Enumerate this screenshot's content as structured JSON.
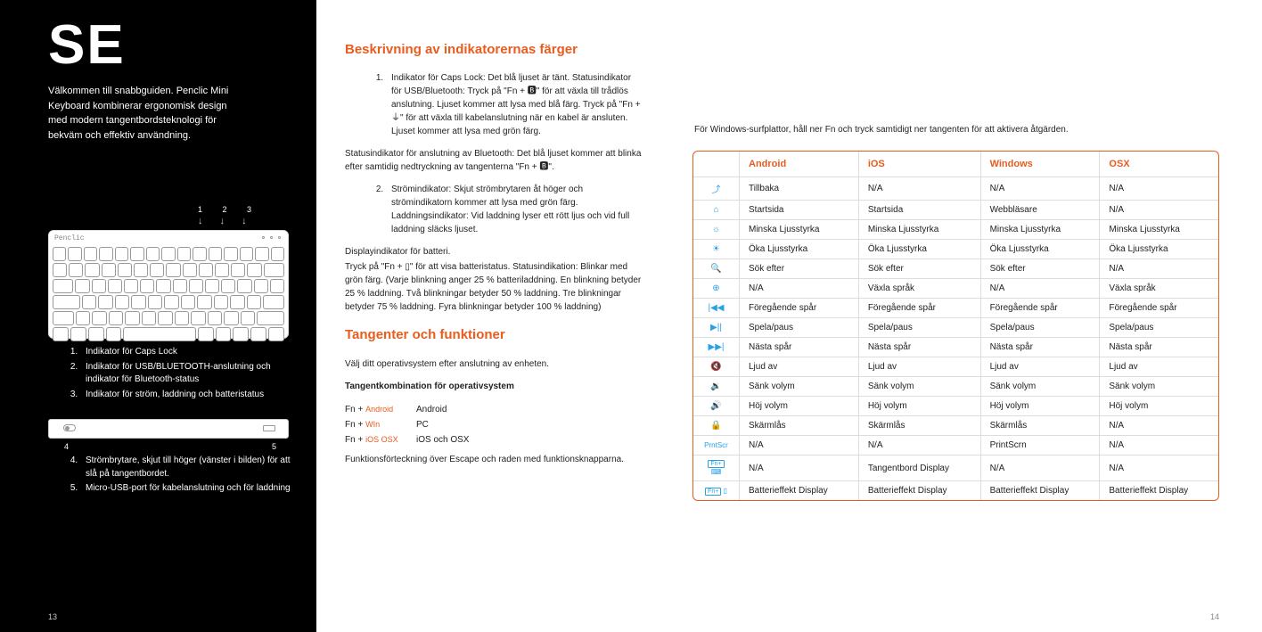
{
  "left": {
    "title": "SE",
    "intro": "Välkommen till snabbguiden. Penclic Mini Keyboard kombinerar ergonomisk design med modern tangentbordsteknologi för bekväm och effektiv användning.",
    "kb_labels": "1 2 3",
    "kb_brand": "Penclic",
    "list1": {
      "i1": "Indikator för Caps Lock",
      "i2": "Indikator för USB/BLUETOOTH-anslutning och indikator för Bluetooth-status",
      "i3": "Indikator för ström, laddning och batteristatus"
    },
    "usb_labels": {
      "l": "4",
      "r": "5"
    },
    "list2": {
      "i4": "Strömbrytare, skjut till höger (vänster i bilden) för att slå på tangentbordet.",
      "i5": "Micro-USB-port för kabelanslutning och för laddning"
    },
    "page": "13"
  },
  "mid": {
    "h1": "Beskrivning av indikatorernas färger",
    "desc1": "Indikator för Caps Lock: Det blå ljuset är tänt. Statusindikator för USB/Bluetooth: Tryck på \"Fn + 🅱\" för att växla till trådlös anslutning. Ljuset kommer att lysa med blå färg. Tryck på \"Fn + ⏚\" för att växla till kabelanslutning när en kabel är ansluten. Ljuset kommer att lysa med grön färg.",
    "para1": "Statusindikator för anslutning av Bluetooth: Det blå ljuset kommer att blinka efter samtidig nedtryckning av tangenterna \"Fn + 🅱\".",
    "desc2": "Strömindikator: Skjut strömbrytaren åt höger och strömindikatorn kommer att lysa med grön färg. Laddningsindikator: Vid laddning lyser ett rött ljus och vid full laddning släcks ljuset.",
    "para2a": "Displayindikator för batteri.",
    "para2b": "Tryck på \"Fn + ▯\" för att visa batteristatus. Statusindikation: Blinkar med grön färg. (Varje blinkning anger 25 % batteriladdning. En blinkning betyder 25 % laddning. Två blinkningar betyder 50 % laddning. Tre blinkningar betyder 75 % laddning. Fyra blinkningar betyder 100 % laddning)",
    "h2": "Tangenter och funktioner",
    "para3": "Välj ditt operativsystem efter anslutning av enheten.",
    "subh": "Tangentkombination för operativsystem",
    "combo": [
      {
        "k": "Fn + ",
        "sym": "Android",
        "v": "Android"
      },
      {
        "k": "Fn + ",
        "sym": "WIn",
        "v": "PC"
      },
      {
        "k": "Fn + ",
        "sym": "iOS OSX",
        "v": "iOS och OSX"
      }
    ],
    "para4": "Funktionsförteckning över Escape och raden med funktionsknapparna."
  },
  "right": {
    "note": "För Windows-surfplattor, håll ner Fn och tryck samtidigt ner tangenten för att aktivera åtgärden.",
    "headers": {
      "c1": "Android",
      "c2": "iOS",
      "c3": "Windows",
      "c4": "OSX"
    },
    "rows": [
      {
        "icon": "⤴",
        "a": "Tillbaka",
        "i": "N/A",
        "w": "N/A",
        "o": "N/A"
      },
      {
        "icon": "⌂",
        "a": "Startsida",
        "i": "Startsida",
        "w": "Webbläsare",
        "o": "N/A"
      },
      {
        "icon": "☼",
        "a": "Minska Ljusstyrka",
        "i": "Minska Ljusstyrka",
        "w": "Minska Ljusstyrka",
        "o": "Minska Ljusstyrka"
      },
      {
        "icon": "☀",
        "a": "Öka Ljusstyrka",
        "i": "Öka Ljusstyrka",
        "w": "Öka Ljusstyrka",
        "o": "Öka Ljusstyrka"
      },
      {
        "icon": "🔍",
        "a": "Sök efter",
        "i": "Sök efter",
        "w": "Sök efter",
        "o": "N/A"
      },
      {
        "icon": "⊕",
        "a": "N/A",
        "i": "Växla språk",
        "w": "N/A",
        "o": "Växla språk"
      },
      {
        "icon": "|◀◀",
        "a": "Föregående spår",
        "i": "Föregående spår",
        "w": "Föregående spår",
        "o": "Föregående spår"
      },
      {
        "icon": "▶||",
        "a": "Spela/paus",
        "i": "Spela/paus",
        "w": "Spela/paus",
        "o": "Spela/paus"
      },
      {
        "icon": "▶▶|",
        "a": "Nästa spår",
        "i": "Nästa spår",
        "w": "Nästa spår",
        "o": "Nästa spår"
      },
      {
        "icon": "🔇",
        "a": "Ljud av",
        "i": "Ljud av",
        "w": "Ljud av",
        "o": "Ljud av"
      },
      {
        "icon": "🔉",
        "a": "Sänk volym",
        "i": "Sänk volym",
        "w": "Sänk volym",
        "o": "Sänk volym"
      },
      {
        "icon": "🔊",
        "a": "Höj volym",
        "i": "Höj volym",
        "w": "Höj volym",
        "o": "Höj volym"
      },
      {
        "icon": "🔒",
        "a": "Skärmlås",
        "i": "Skärmlås",
        "w": "Skärmlås",
        "o": "N/A"
      },
      {
        "icon": "PrntScr",
        "a": "N/A",
        "i": "N/A",
        "w": "PrintScrn",
        "o": "N/A"
      },
      {
        "icon": "Fn+⌨",
        "a": "N/A",
        "i": "Tangentbord Display",
        "w": "N/A",
        "o": "N/A"
      },
      {
        "icon": "Fn+▯",
        "a": "Batterieffekt Display",
        "i": "Batterieffekt Display",
        "w": "Batterieffekt Display",
        "o": "Batterieffekt Display"
      }
    ],
    "page": "14"
  }
}
